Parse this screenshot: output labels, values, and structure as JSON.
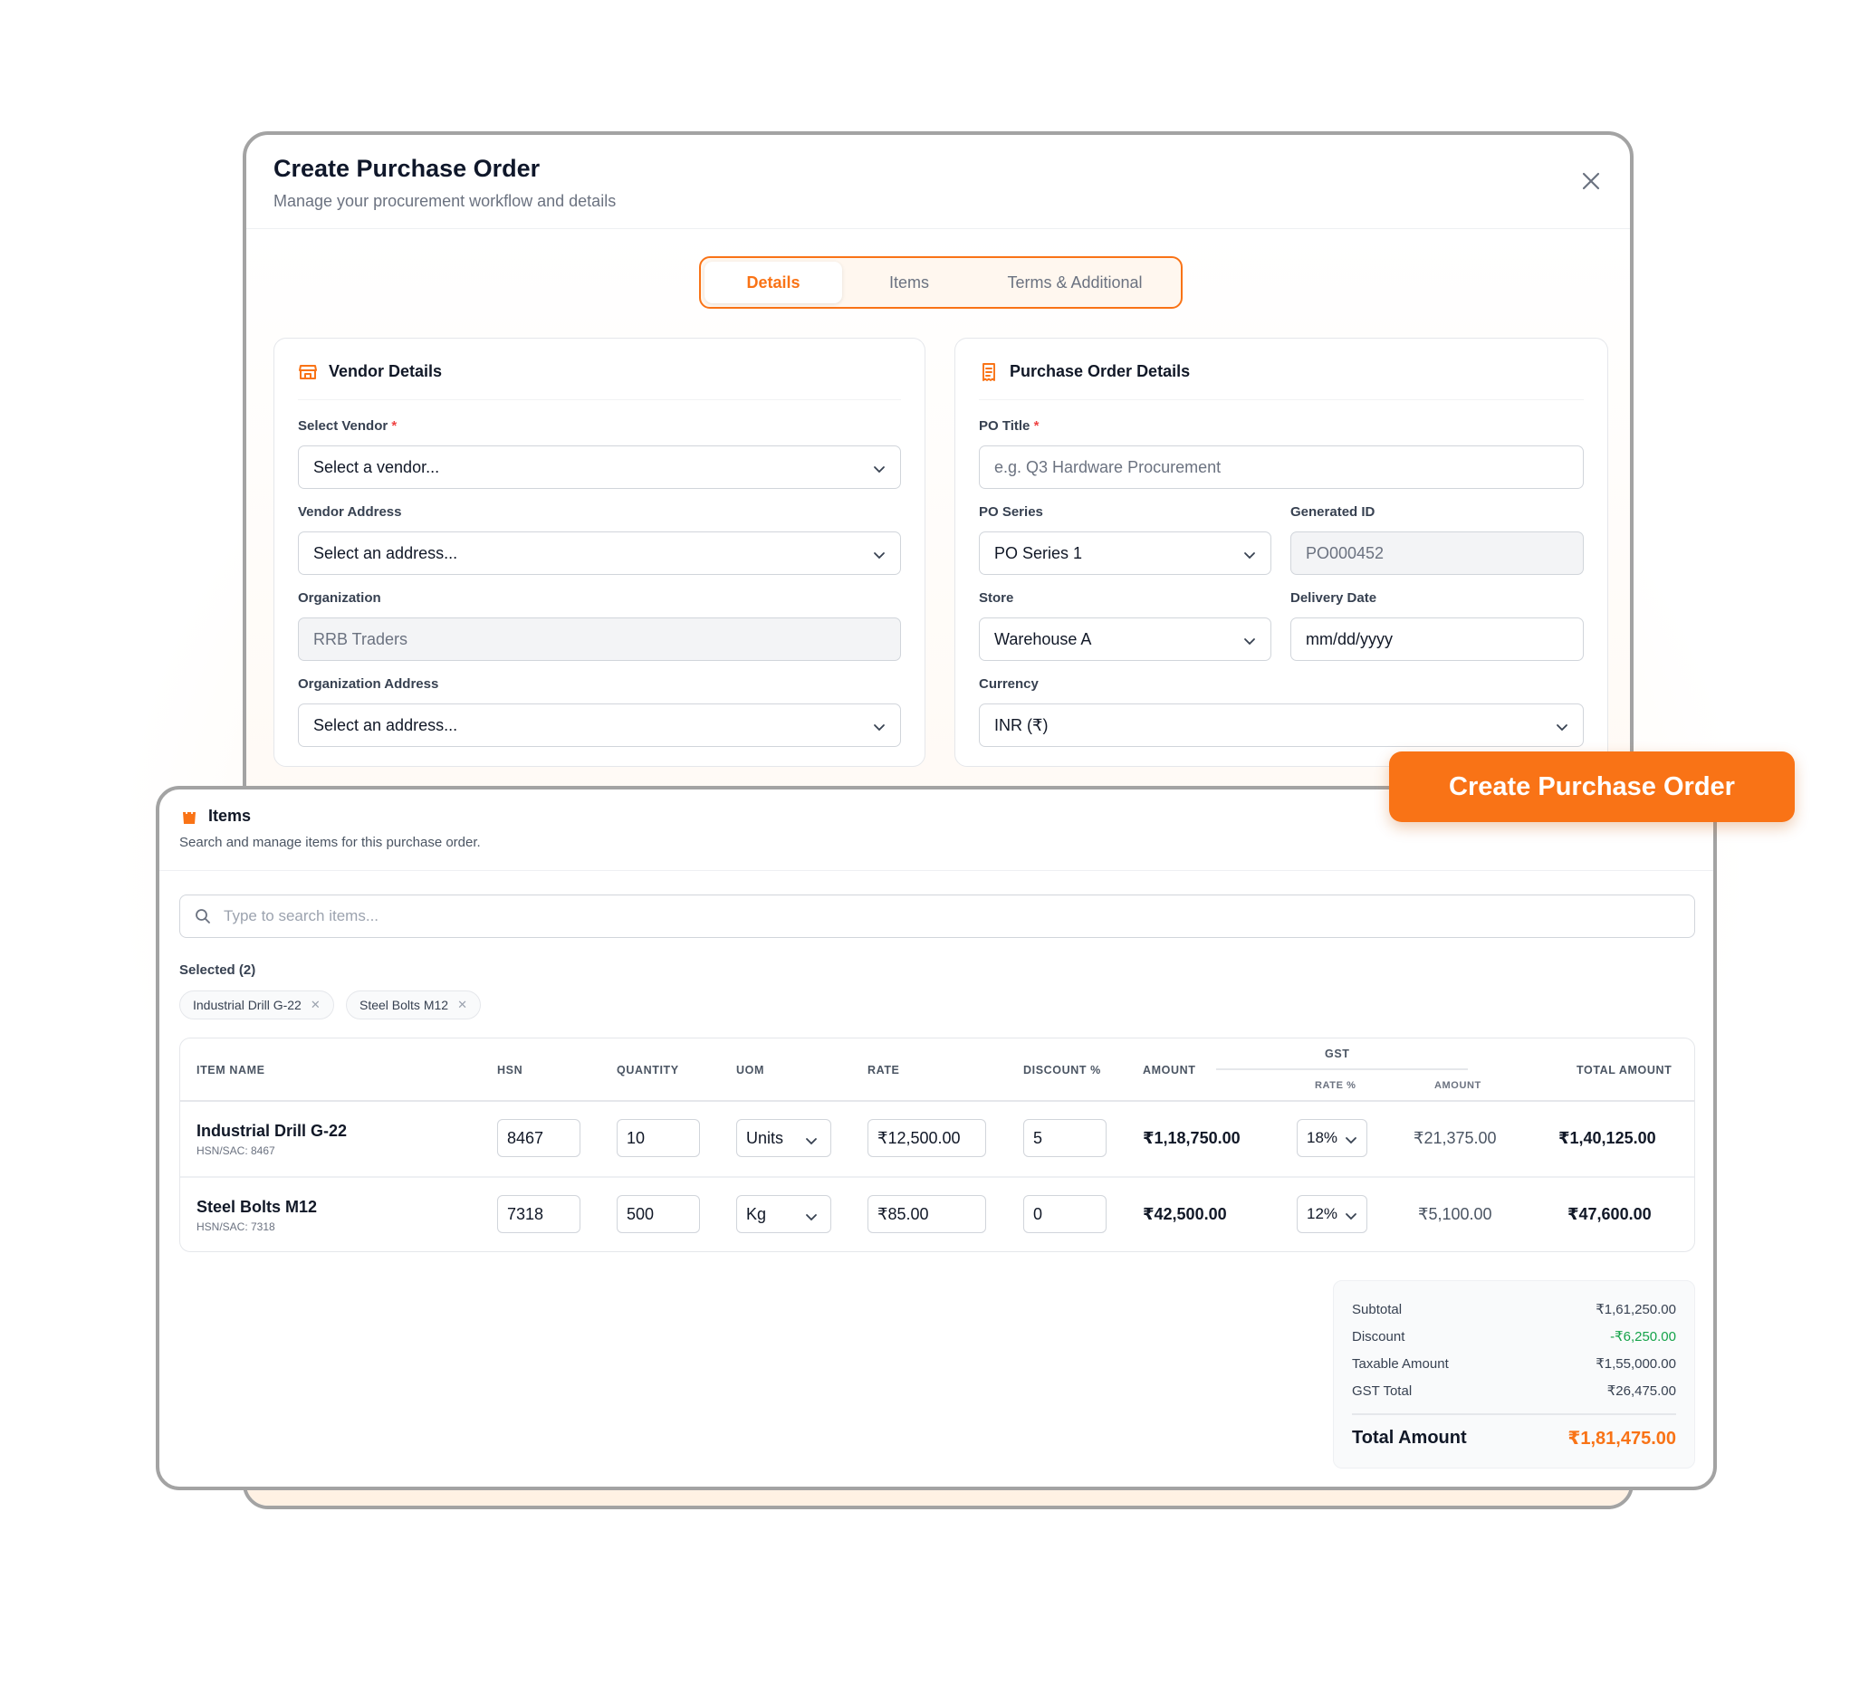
{
  "brand": {
    "accent": "#f97316",
    "success": "#16a34a",
    "required": "#ef4444"
  },
  "modal": {
    "title": "Create Purchase Order",
    "subtitle": "Manage your procurement workflow and details",
    "close_icon": "close-icon"
  },
  "tabs": [
    {
      "label": "Details",
      "active": true
    },
    {
      "label": "Items",
      "active": false
    },
    {
      "label": "Terms & Additional",
      "active": false
    }
  ],
  "vendor": {
    "title": "Vendor Details",
    "icon": "store-icon",
    "select_vendor": {
      "label": "Select Vendor",
      "value": "Select a vendor..."
    },
    "vendor_address": {
      "label": "Vendor Address",
      "value": "Select an address..."
    },
    "organization": {
      "label": "Organization",
      "value": "RRB Traders"
    },
    "org_address": {
      "label": "Organization Address",
      "value": "Select an address..."
    }
  },
  "po": {
    "title": "Purchase Order Details",
    "icon": "receipt-icon",
    "po_title": {
      "label": "PO Title",
      "placeholder": "e.g. Q3 Hardware Procurement"
    },
    "po_series": {
      "label": "PO Series",
      "value": "PO Series 1"
    },
    "generated_id": {
      "label": "Generated ID",
      "value": "PO000452"
    },
    "store": {
      "label": "Store",
      "value": "Warehouse A"
    },
    "delivery_date": {
      "label": "Delivery Date",
      "value": "mm/dd/yyyy"
    },
    "currency": {
      "label": "Currency",
      "value": "INR (₹)"
    }
  },
  "cta": {
    "label": "Create Purchase Order"
  },
  "items_panel": {
    "title": "Items",
    "icon": "shopping-bag-icon",
    "subtitle": "Search and manage items for this purchase order.",
    "search_placeholder": "Type to search items...",
    "selected_label": "Selected (2)",
    "chips": [
      "Industrial Drill G-22",
      "Steel Bolts M12"
    ]
  },
  "table": {
    "headers": {
      "item_name": "ITEM NAME",
      "hsn": "HSN",
      "quantity": "QUANTITY",
      "uom": "UOM",
      "rate": "RATE",
      "discount": "DISCOUNT %",
      "amount": "AMOUNT",
      "gst": "GST",
      "gst_rate": "RATE %",
      "gst_amount": "AMOUNT",
      "total": "TOTAL AMOUNT"
    },
    "rows": [
      {
        "name": "Industrial Drill G-22",
        "hsn_sac": "HSN/SAC: 8467",
        "hsn": "8467",
        "quantity": "10",
        "uom": "Units",
        "rate": "₹12,500.00",
        "discount": "5",
        "amount": "₹1,18,750.00",
        "gst_rate": "18%",
        "gst_amount": "₹21,375.00",
        "total": "₹1,40,125.00"
      },
      {
        "name": "Steel Bolts M12",
        "hsn_sac": "HSN/SAC: 7318",
        "hsn": "7318",
        "quantity": "500",
        "uom": "Kg",
        "rate": "₹85.00",
        "discount": "0",
        "amount": "₹42,500.00",
        "gst_rate": "12%",
        "gst_amount": "₹5,100.00",
        "total": "₹47,600.00"
      }
    ]
  },
  "summary": {
    "subtotal": {
      "label": "Subtotal",
      "value": "₹1,61,250.00"
    },
    "discount": {
      "label": "Discount",
      "value": "-₹6,250.00"
    },
    "taxable": {
      "label": "Taxable Amount",
      "value": "₹1,55,000.00"
    },
    "gst_total": {
      "label": "GST Total",
      "value": "₹26,475.00"
    },
    "total": {
      "label": "Total Amount",
      "value": "₹1,81,475.00"
    }
  }
}
